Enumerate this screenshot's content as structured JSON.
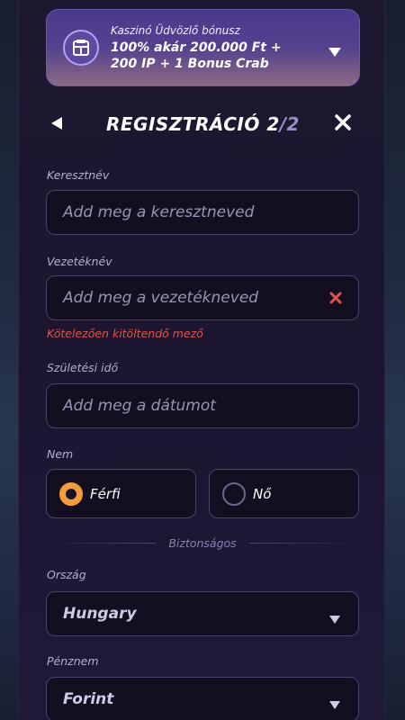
{
  "bonus": {
    "title": "Kaszinó Üdvözlő bónusz",
    "line1": "100% akár 200.000 Ft +",
    "line2": "200 IP + 1 Bonus Crab"
  },
  "header": {
    "title": "REGISZTRÁCIÓ 2",
    "title_total": "/2"
  },
  "form": {
    "first_name": {
      "label": "Keresztnév",
      "placeholder": "Add meg a keresztneved"
    },
    "last_name": {
      "label": "Vezetéknév",
      "placeholder": "Add meg a vezetékneved",
      "error": "Kötelezően kitöltendő mező"
    },
    "birth_date": {
      "label": "Születési idő",
      "placeholder": "Add meg a dátumot"
    },
    "gender": {
      "label": "Nem",
      "options": [
        {
          "label": "Férfi",
          "checked": true
        },
        {
          "label": "Nő",
          "checked": false
        }
      ]
    },
    "divider": "Biztonságos",
    "country": {
      "label": "Ország",
      "value": "Hungary"
    },
    "currency": {
      "label": "Pénznem",
      "value": "Forint"
    }
  },
  "colors": {
    "accent": "#f59b3a",
    "error": "#e2534b",
    "bonus_bg": "#4b3a8c"
  }
}
